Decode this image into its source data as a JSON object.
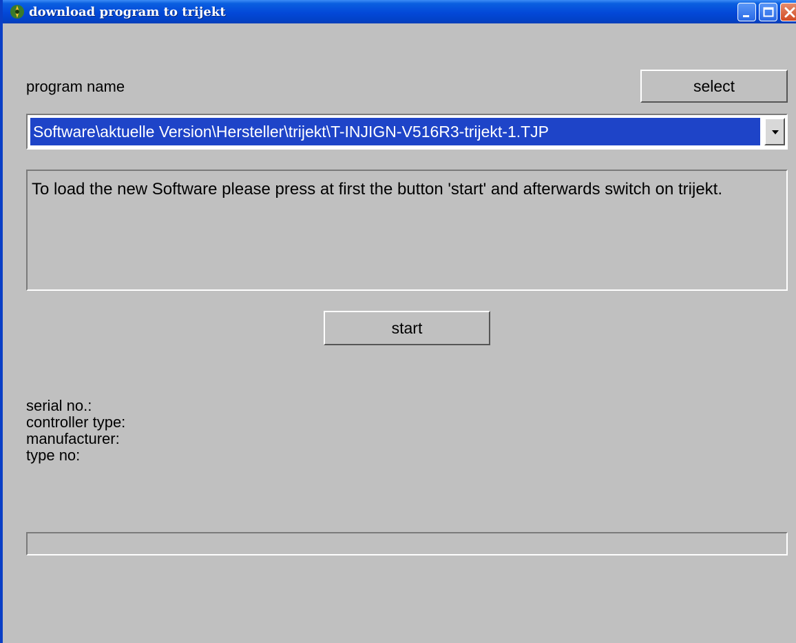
{
  "window": {
    "title": "download program to trijekt"
  },
  "program": {
    "label": "program name",
    "select_label": "select",
    "selected_path": "Software\\aktuelle Version\\Hersteller\\trijekt\\T-INJIGN-V516R3-trijekt-1.TJP"
  },
  "message": {
    "text": "To load the new Software please press at first the button 'start' and afterwards switch on trijekt."
  },
  "actions": {
    "start_label": "start"
  },
  "info": {
    "serial_label": "serial no.:",
    "controller_label": "controller type:",
    "manufacturer_label": "manufacturer:",
    "type_label": "type no:"
  },
  "progress": {
    "value": 0
  },
  "colors": {
    "titlebar": "#0348d8",
    "selection": "#1e44c8",
    "face": "#c0c0c0",
    "close_button": "#d24a22"
  },
  "icons": {
    "app": "app-icon",
    "minimize": "minimize-icon",
    "maximize": "maximize-icon",
    "close": "close-icon",
    "dropdown": "chevron-down-icon"
  }
}
